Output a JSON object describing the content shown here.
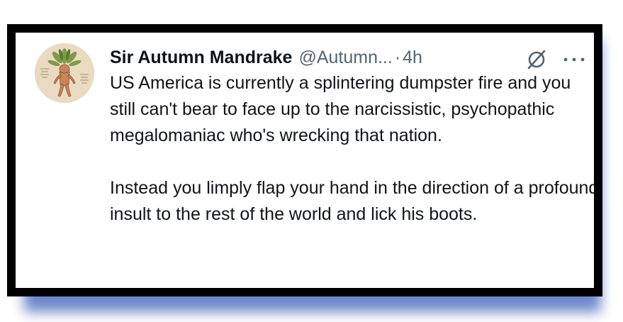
{
  "tweet": {
    "author": {
      "display_name": "Sir Autumn Mandrake",
      "handle": "@Autumn...",
      "avatar_icon": "mandrake-root-illustration"
    },
    "separator": "·",
    "time": "4h",
    "grok_icon": "grok-icon",
    "more_icon": "more-dots-icon",
    "paragraphs": [
      "US America is currently a splintering dumpster fire and you still can't bear to face up to the narcissistic, psychopathic megalomaniac who's wrecking that nation.",
      "Instead you limply flap your hand in the direction of a profound insult to the rest of the world and lick his boots."
    ]
  },
  "colors": {
    "frame": "#000000",
    "shadow": "#3b5fb8",
    "text_primary": "#0f1419",
    "text_secondary": "#536471",
    "avatar_background": "#e6d7bb"
  }
}
